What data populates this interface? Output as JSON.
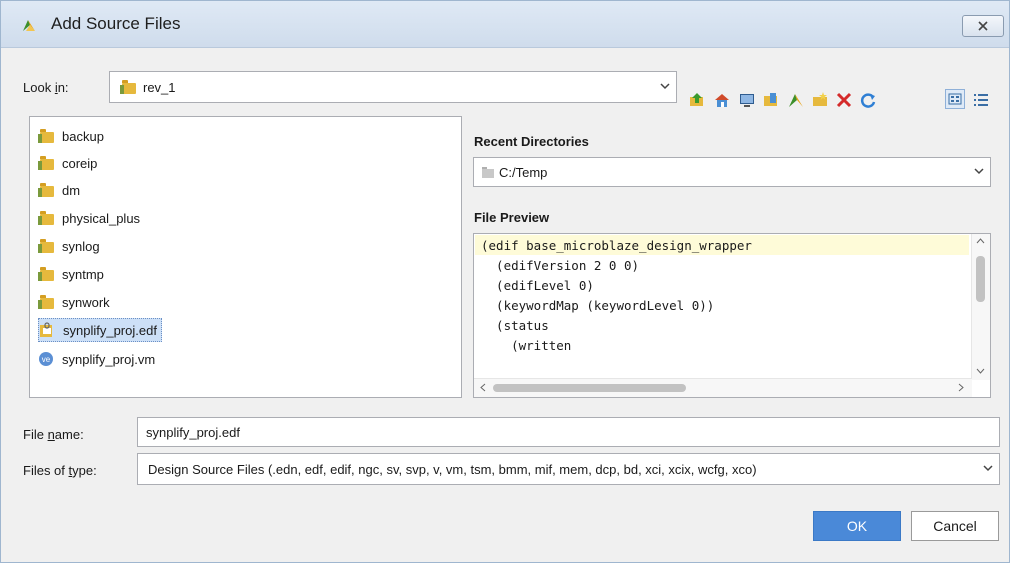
{
  "window": {
    "title": "Add Source Files",
    "close_icon": "close-icon"
  },
  "look_in": {
    "label_pre": "Look ",
    "label_u": "i",
    "label_post": "n:",
    "value": "rev_1"
  },
  "toolbar": {
    "icons": [
      "up-folder-icon",
      "home-icon",
      "desktop-icon",
      "bookmarks-icon",
      "project-icon",
      "new-folder-icon",
      "delete-icon",
      "refresh-icon",
      "list-view-icon",
      "details-view-icon"
    ]
  },
  "files": [
    {
      "name": "backup",
      "type": "folder"
    },
    {
      "name": "coreip",
      "type": "folder"
    },
    {
      "name": "dm",
      "type": "folder"
    },
    {
      "name": "physical_plus",
      "type": "folder"
    },
    {
      "name": "synlog",
      "type": "folder"
    },
    {
      "name": "syntmp",
      "type": "folder"
    },
    {
      "name": "synwork",
      "type": "folder"
    },
    {
      "name": "synplify_proj.edf",
      "type": "edf",
      "selected": true
    },
    {
      "name": "synplify_proj.vm",
      "type": "vm",
      "badge": "ve"
    }
  ],
  "recent": {
    "title": "Recent Directories",
    "value": "C:/Temp"
  },
  "preview": {
    "title": "File Preview",
    "lines": [
      "(edif base_microblaze_design_wrapper",
      "  (edifVersion 2 0 0)",
      "  (edifLevel 0)",
      "  (keywordMap (keywordLevel 0))",
      "  (status",
      "    (written"
    ]
  },
  "file_name": {
    "label_pre": "File ",
    "label_u": "n",
    "label_post": "ame:",
    "value": "synplify_proj.edf"
  },
  "file_type": {
    "label_pre": "Files of ",
    "label_u": "t",
    "label_post": "ype:",
    "value": "Design Source Files (.edn, edf, edif, ngc, sv, svp, v, vm, tsm, bmm, mif, mem, dcp, bd, xci, xcix, wcfg, xco)"
  },
  "buttons": {
    "ok": "OK",
    "cancel": "Cancel"
  }
}
